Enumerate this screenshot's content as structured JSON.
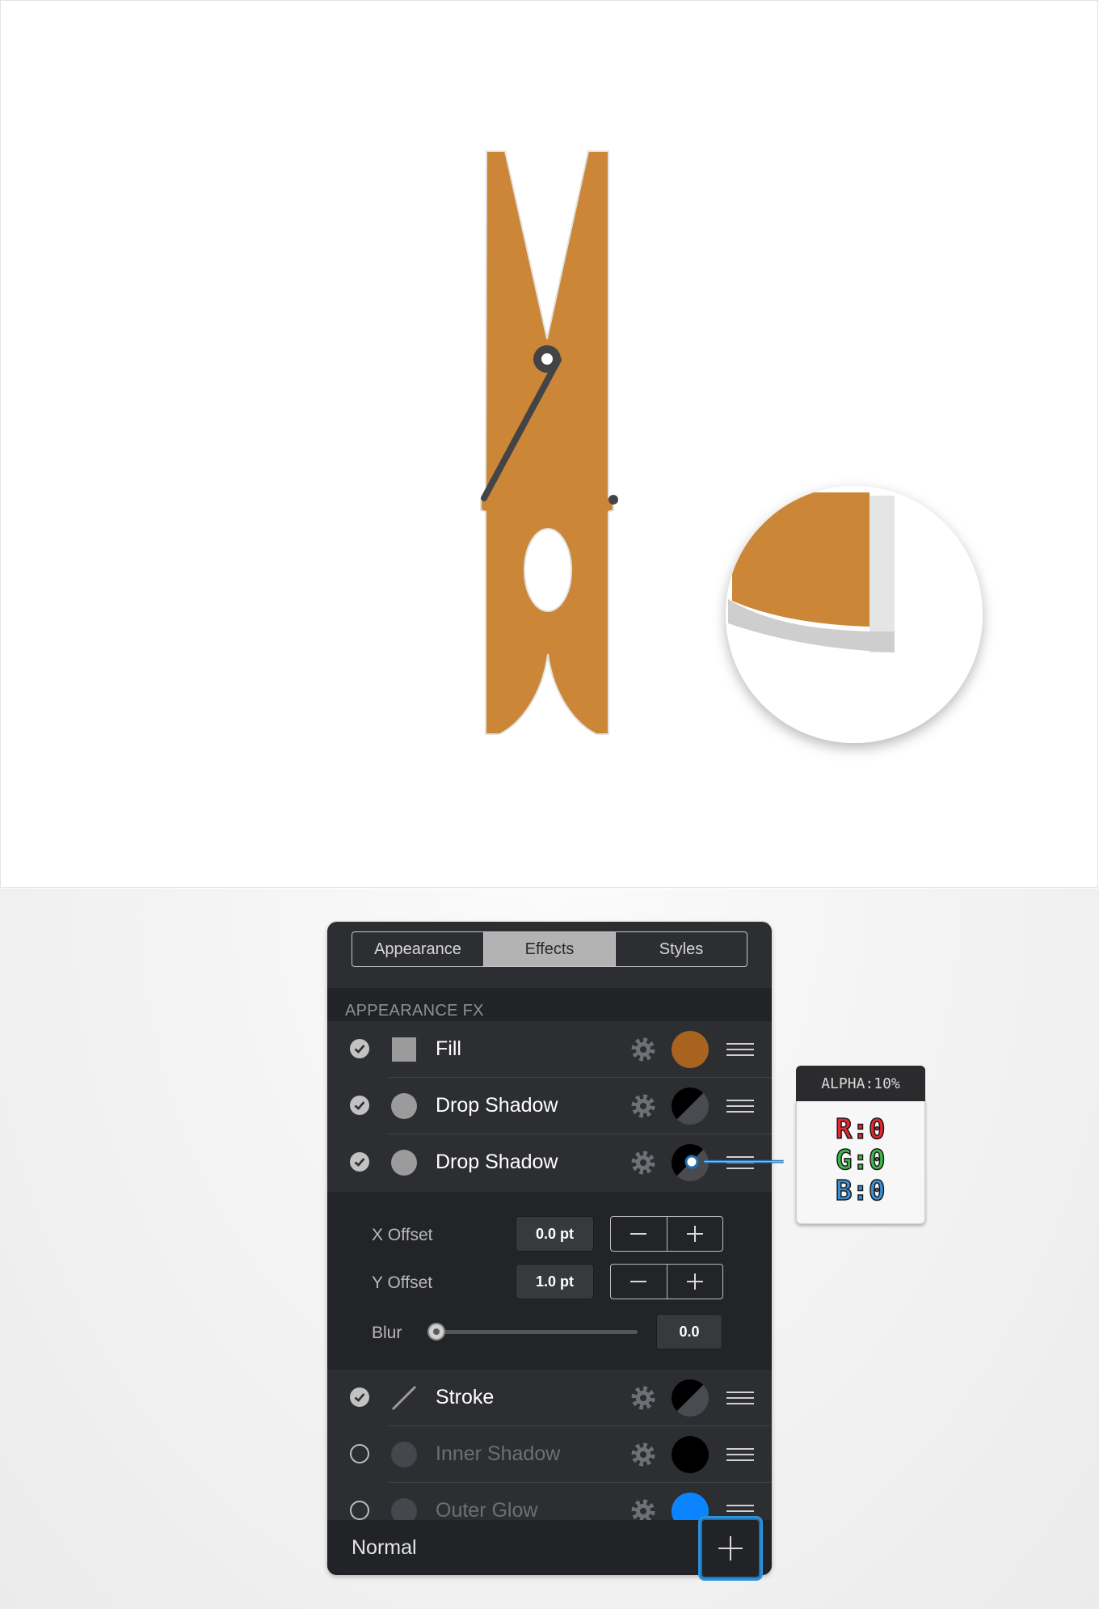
{
  "tabs": {
    "appearance": "Appearance",
    "effects": "Effects",
    "styles": "Styles",
    "active": "Effects"
  },
  "section_title": "APPEARANCE FX",
  "effects": [
    {
      "label": "Fill",
      "enabled": true,
      "icon": "square-icon",
      "swatch": "#a8631f"
    },
    {
      "label": "Drop Shadow",
      "enabled": true,
      "icon": "circle-icon",
      "swatch": "black-half-icon"
    },
    {
      "label": "Drop Shadow",
      "enabled": true,
      "icon": "circle-icon",
      "swatch": "black-half-icon"
    },
    {
      "label": "Stroke",
      "enabled": true,
      "icon": "line-icon",
      "swatch": "black-half-icon"
    },
    {
      "label": "Inner Shadow",
      "enabled": false,
      "icon": "circle-icon",
      "swatch": "#000000"
    },
    {
      "label": "Outer Glow",
      "enabled": false,
      "icon": "circle-icon",
      "swatch": "#0a84ff"
    }
  ],
  "settings": {
    "x_offset_label": "X Offset",
    "x_offset_value": "0.0 pt",
    "y_offset_label": "Y Offset",
    "y_offset_value": "1.0 pt",
    "blur_label": "Blur",
    "blur_value": "0.0"
  },
  "footer": {
    "blend_mode": "Normal"
  },
  "callout": {
    "alpha": "ALPHA:10%",
    "r": "R:0",
    "g": "G:0",
    "b": "B:0"
  },
  "colors": {
    "clothespin": "#cc8637",
    "panel_bg": "#2d2e32",
    "accent_blue": "#2d92dd",
    "fill_swatch": "#a8631f",
    "glow_swatch": "#0a84ff"
  }
}
